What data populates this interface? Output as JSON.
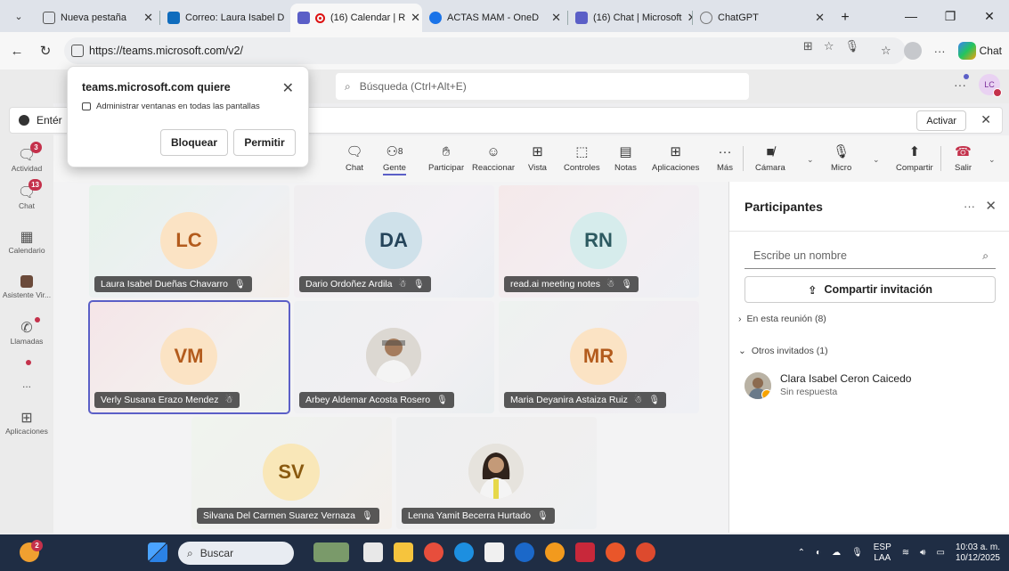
{
  "browser": {
    "tabs": [
      {
        "label": "Nueva pestaña",
        "favicon": "new-tab-icon"
      },
      {
        "label": "Correo: Laura Isabel D",
        "favicon": "outlook-icon"
      },
      {
        "label": "(16) Calendar | R",
        "favicon": "teams-icon",
        "active": true,
        "recording": true
      },
      {
        "label": "ACTAS MAM - OneD",
        "favicon": "onedrive-icon"
      },
      {
        "label": "(16) Chat | Microsoft",
        "favicon": "teams-icon"
      },
      {
        "label": "ChatGPT",
        "favicon": "chatgpt-icon"
      }
    ],
    "url": "https://teams.microsoft.com/v2/",
    "copilot_label": "Chat"
  },
  "teams": {
    "rail": [
      {
        "label": "Actividad",
        "icon": "bell-icon",
        "badge": "3"
      },
      {
        "label": "Chat",
        "icon": "chat-icon",
        "badge": "13"
      },
      {
        "label": "Calendario",
        "icon": "calendar-icon"
      },
      {
        "label": "Asistente Vir...",
        "icon": "assistant-icon"
      },
      {
        "label": "Llamadas",
        "icon": "phone-icon",
        "dot": true
      },
      {
        "label": "...",
        "icon": "more-icon",
        "dot": true
      },
      {
        "label": "Aplicaciones",
        "icon": "apps-icon"
      }
    ],
    "search_placeholder": "Búsqueda (Ctrl+Alt+E)",
    "user_initials": "LC",
    "notification": {
      "text": "Entér",
      "action": "Activar"
    },
    "toolbar": {
      "chat": "Chat",
      "people": "Gente",
      "people_count": "8",
      "raise": "Participar",
      "react": "Reaccionar",
      "view": "Vista",
      "controls": "Controles",
      "notes": "Notas",
      "apps": "Aplicaciones",
      "more": "Más",
      "camera": "Cámara",
      "mic": "Micro",
      "share": "Compartir",
      "leave": "Salir"
    },
    "tiles": [
      {
        "initials": "LC",
        "name": "Laura Isabel Dueñas Chavarro",
        "mic_off": true
      },
      {
        "initials": "DA",
        "name": "Dario Ordoñez Ardila",
        "mic_off": true,
        "guest": true
      },
      {
        "initials": "RN",
        "name": "read.ai meeting notes",
        "mic_off": true,
        "guest": true
      },
      {
        "initials": "VM",
        "name": "Verly Susana Erazo Mendez",
        "guest": true,
        "selected": true
      },
      {
        "initials": "",
        "name": "Arbey Aldemar Acosta Rosero",
        "mic_off": true,
        "photo": true
      },
      {
        "initials": "MR",
        "name": "Maria Deyanira Astaiza Ruiz",
        "mic_off": true,
        "guest": true
      },
      {
        "initials": "SV",
        "name": "Silvana Del Carmen Suarez Vernaza",
        "mic_off": true
      },
      {
        "initials": "",
        "name": "Lenna Yamit Becerra Hurtado",
        "mic_off": true,
        "photo": true
      }
    ],
    "participants": {
      "title": "Participantes",
      "search_placeholder": "Escribe un nombre",
      "invite": "Compartir invitación",
      "in_meeting": "En esta reunión (8)",
      "others": "Otros invitados (1)",
      "person_name": "Clara Isabel Ceron Caicedo",
      "person_status": "Sin respuesta"
    }
  },
  "popup": {
    "title": "teams.microsoft.com quiere",
    "desc": "Administrar ventanas en todas las pantallas",
    "block": "Bloquear",
    "allow": "Permitir"
  },
  "taskbar": {
    "search": "Buscar",
    "lang_top": "ESP",
    "lang_bottom": "LAA",
    "time": "10:03 a. m.",
    "date": "10/12/2025",
    "weather_badge": "2"
  },
  "colors": {
    "accent": "#5b5fc7",
    "leave": "#c4314b"
  }
}
